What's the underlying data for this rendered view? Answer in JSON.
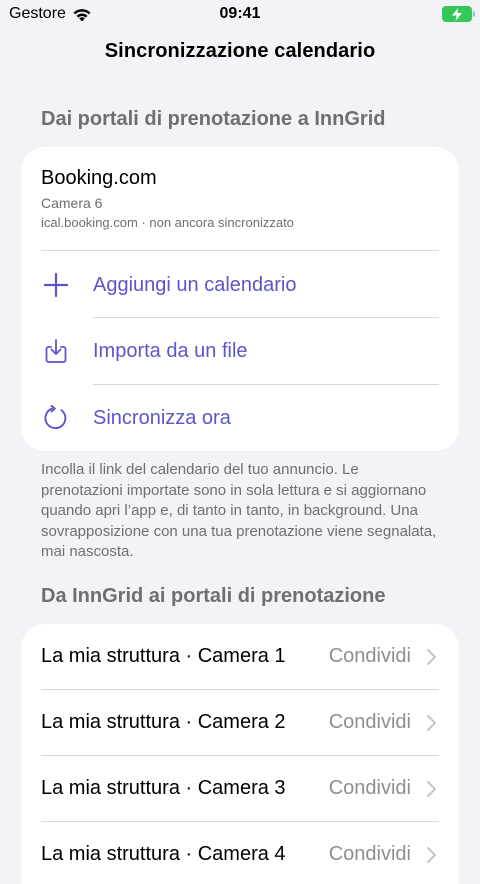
{
  "status_bar": {
    "carrier": "Gestore",
    "time": "09:41"
  },
  "nav": {
    "title": "Sincronizzazione calendario"
  },
  "import_section": {
    "header": "Dai portali di prenotazione a InnGrid",
    "source": {
      "name": "Booking.com",
      "room": "Camera 6",
      "meta": "ical.booking.com · non ancora sincronizzato"
    },
    "actions": [
      {
        "label": "Aggiungi un calendario",
        "icon": "plus-icon"
      },
      {
        "label": "Importa da un file",
        "icon": "import-file-icon"
      },
      {
        "label": "Sincronizza ora",
        "icon": "sync-icon"
      }
    ],
    "footnote": "Incolla il link del calendario del tuo annuncio. Le prenotazioni importate sono in sola lettura e si aggiornano quando apri l’app e, di tanto in tanto, in background. Una sovrapposizione con una tua prenotazione viene segnalata, mai nascosta."
  },
  "export_section": {
    "header": "Da InnGrid ai portali di prenotazione",
    "rows": [
      {
        "label": "La mia struttura · Camera 1",
        "action": "Condividi"
      },
      {
        "label": "La mia struttura · Camera 2",
        "action": "Condividi"
      },
      {
        "label": "La mia struttura · Camera 3",
        "action": "Condividi"
      },
      {
        "label": "La mia struttura · Camera 4",
        "action": "Condividi"
      }
    ]
  },
  "colors": {
    "accent": "#5b56c9",
    "background": "#f2f2f7",
    "secondary_text": "#6e6e73",
    "battery": "#34c759"
  }
}
